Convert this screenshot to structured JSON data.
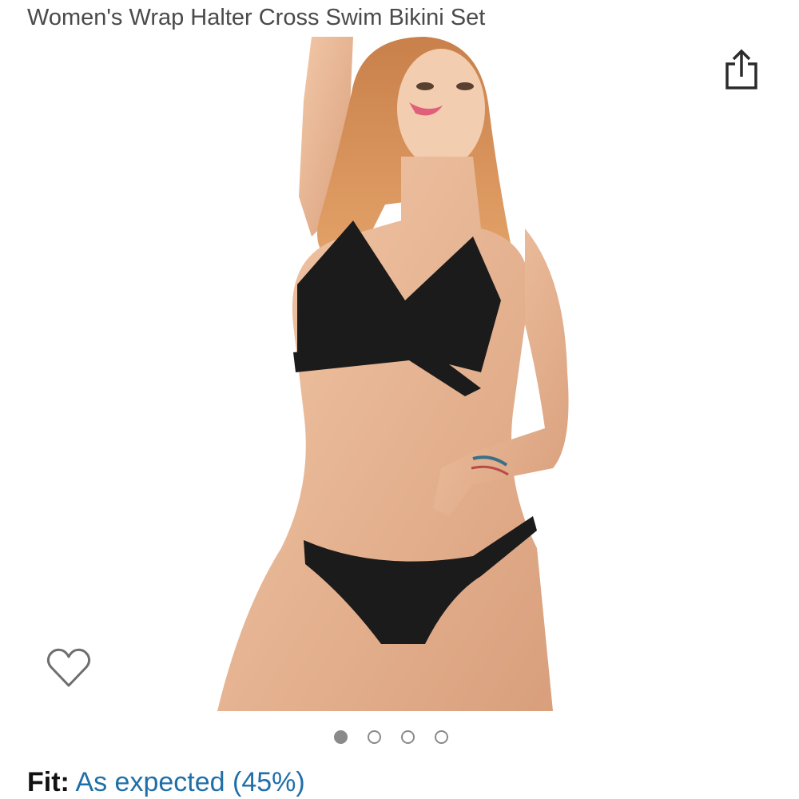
{
  "product": {
    "title": "Women's Wrap Halter Cross Swim Bikini Set"
  },
  "icons": {
    "share": "share-icon",
    "wishlist": "heart-outline-icon"
  },
  "carousel": {
    "total_images": 4,
    "active_index": 0
  },
  "fit": {
    "label": "Fit:",
    "value": "As expected (45%)"
  },
  "colors": {
    "link": "#1f6fa8",
    "title": "#4a4a4a",
    "dot": "#8a8a8a"
  }
}
